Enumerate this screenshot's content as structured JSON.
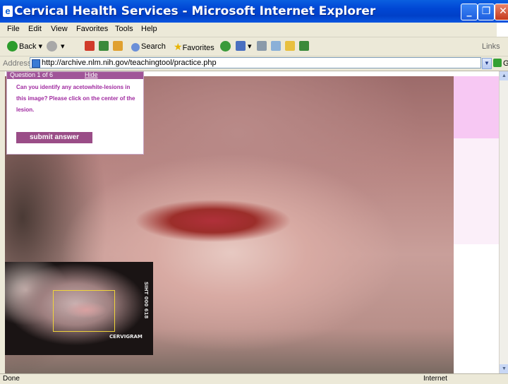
{
  "window": {
    "title": "Cervical Health Services - Microsoft Internet Explorer"
  },
  "menu": [
    "File",
    "Edit",
    "View",
    "Favorites",
    "Tools",
    "Help"
  ],
  "toolbar": {
    "back": "Back",
    "search": "Search",
    "favorites": "Favorites",
    "links": "Links"
  },
  "address": {
    "label": "Address",
    "url": "http://archive.nlm.nih.gov/teachingtool/practice.php",
    "go": "Go"
  },
  "question": {
    "counter": "Question 1 of 6",
    "hide": "Hide",
    "text": "Can you identify any acetowhite-lesions in this image? Please click on the center of the lesion.",
    "submit": "submit answer"
  },
  "thumbnail": {
    "side_text": "SIHT 000 618",
    "brand": "CERVIGRAM"
  },
  "status": {
    "left": "Done",
    "zone": "Internet"
  }
}
